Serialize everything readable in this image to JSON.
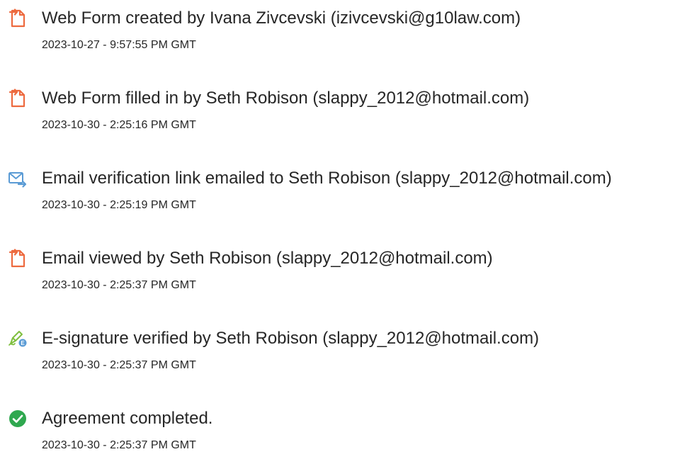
{
  "colors": {
    "text": "#262626",
    "document_icon": "#ED6A3F",
    "email_icon": "#5A9BD5",
    "signature_icon": "#7FBF3F",
    "complete_icon": "#2FA84F"
  },
  "events": [
    {
      "icon": "document-icon",
      "title": "Web Form created by Ivana Zivcevski (izivcevski@g10law.com)",
      "timestamp": "2023-10-27 - 9:57:55 PM GMT"
    },
    {
      "icon": "document-icon",
      "title": "Web Form filled in by Seth Robison (slappy_2012@hotmail.com)",
      "timestamp": "2023-10-30 - 2:25:16 PM GMT"
    },
    {
      "icon": "email-sent-icon",
      "title": "Email verification link emailed to Seth Robison (slappy_2012@hotmail.com)",
      "timestamp": "2023-10-30 - 2:25:19 PM GMT"
    },
    {
      "icon": "document-icon",
      "title": "Email viewed by Seth Robison (slappy_2012@hotmail.com)",
      "timestamp": "2023-10-30 - 2:25:37 PM GMT"
    },
    {
      "icon": "signature-verified-icon",
      "title": "E-signature verified by Seth Robison (slappy_2012@hotmail.com)",
      "timestamp": "2023-10-30 - 2:25:37 PM GMT"
    },
    {
      "icon": "checkmark-circle-icon",
      "title": "Agreement completed.",
      "timestamp": "2023-10-30 - 2:25:37 PM GMT"
    }
  ]
}
